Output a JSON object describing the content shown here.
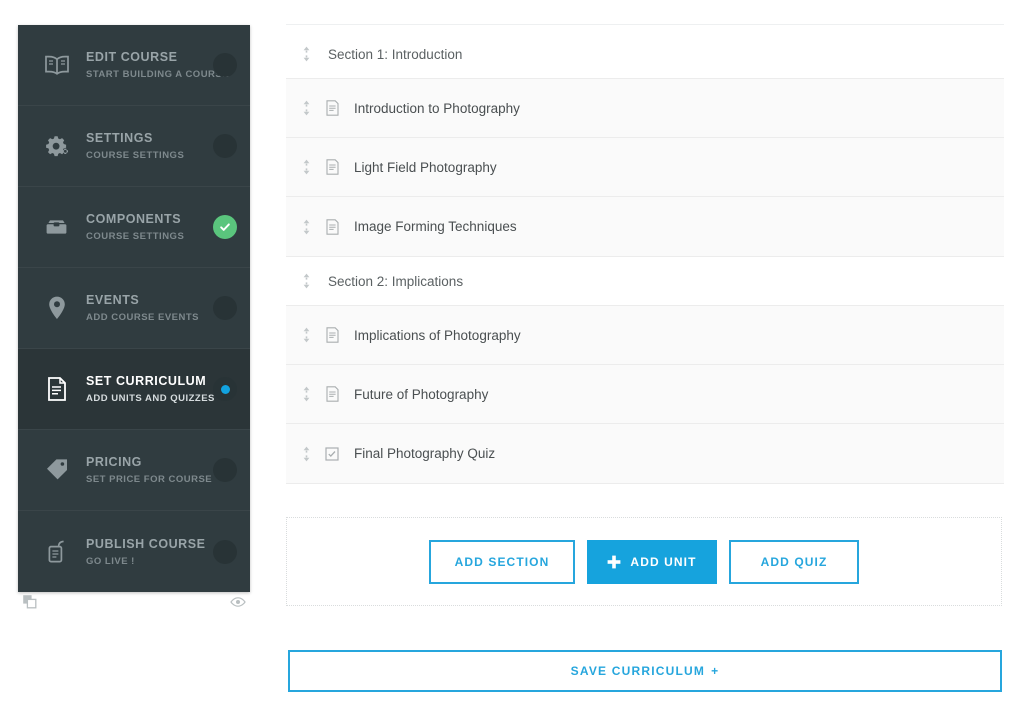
{
  "sidebar": {
    "items": [
      {
        "title": "EDIT COURSE",
        "subtitle": "START BUILDING A COURSE",
        "icon": "book-icon",
        "status": "pending",
        "active": false
      },
      {
        "title": "SETTINGS",
        "subtitle": "COURSE SETTINGS",
        "icon": "gears-icon",
        "status": "pending",
        "active": false
      },
      {
        "title": "COMPONENTS",
        "subtitle": "COURSE SETTINGS",
        "icon": "toolbox-icon",
        "status": "done",
        "active": false
      },
      {
        "title": "EVENTS",
        "subtitle": "ADD COURSE EVENTS",
        "icon": "map-pin-icon",
        "status": "pending",
        "active": false
      },
      {
        "title": "SET CURRICULUM",
        "subtitle": "ADD UNITS AND QUIZZES",
        "icon": "document-list-icon",
        "status": "current",
        "active": true
      },
      {
        "title": "PRICING",
        "subtitle": "SET PRICE FOR COURSE",
        "icon": "price-tag-icon",
        "status": "pending",
        "active": false
      },
      {
        "title": "PUBLISH COURSE",
        "subtitle": "GO LIVE !",
        "icon": "publish-icon",
        "status": "pending",
        "active": false
      }
    ],
    "footer": {
      "duplicate_icon": "duplicate-icon",
      "preview_icon": "eye-preview-icon"
    },
    "colors": {
      "background": "#303c40",
      "active_background": "#2b3538",
      "done_badge": "#5ac57d",
      "current_dot": "#12a3e0"
    }
  },
  "curriculum": {
    "sections": [
      {
        "label": "Section 1: Introduction",
        "items": [
          {
            "label": "Introduction to Photography",
            "type": "unit",
            "icon": "unit-document-icon"
          },
          {
            "label": "Light Field Photography",
            "type": "unit",
            "icon": "unit-document-icon"
          },
          {
            "label": "Image Forming Techniques",
            "type": "unit",
            "icon": "unit-document-icon"
          }
        ]
      },
      {
        "label": "Section 2: Implications",
        "items": [
          {
            "label": "Implications of Photography",
            "type": "unit",
            "icon": "unit-document-icon"
          },
          {
            "label": "Future of Photography",
            "type": "unit",
            "icon": "unit-document-icon"
          },
          {
            "label": "Final Photography Quiz",
            "type": "quiz",
            "icon": "quiz-checkbox-icon"
          }
        ]
      }
    ]
  },
  "actions": {
    "add_section": "Add Section",
    "add_unit": "Add Unit",
    "add_quiz": "Add Quiz",
    "save_curriculum": "Save Curriculum",
    "save_suffix": "+",
    "accent_color": "#26a6dd",
    "primary_color": "#16a3dd"
  }
}
